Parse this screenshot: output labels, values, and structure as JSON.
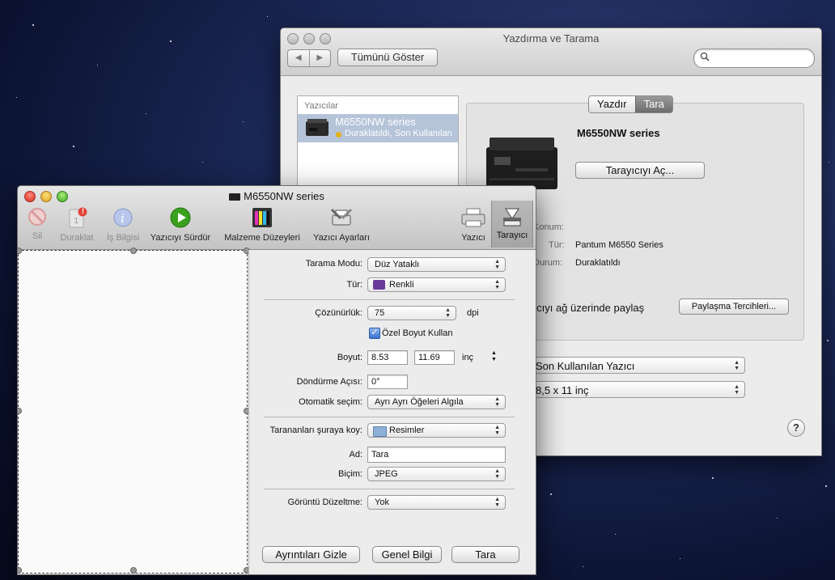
{
  "back_window": {
    "title": "Yazdırma ve Tarama",
    "show_all": "Tümünü Göster",
    "search_placeholder": "",
    "list_header": "Yazıcılar",
    "printer": {
      "name": "M6550NW series",
      "status": "Duraklatıldı, Son Kullanılan"
    },
    "tabs": [
      "Yazdır",
      "Tara"
    ],
    "active_tab": "Tara",
    "detail": {
      "name": "M6550NW series",
      "open_scanner": "Tarayıcıyı Aç...",
      "location_label": "Konum:",
      "kind_label": "Tür:",
      "kind_value": "Pantum M6550 Series",
      "status_label": "Durum:",
      "status_value": "Duraklatıldı",
      "share_text": "yıcıyı ağ üzerinde paylaş",
      "sharing_prefs": "Paylaşma Tercihleri..."
    },
    "default_printer": "Son Kullanılan Yazıcı",
    "paper_size": "8,5 x 11 inç",
    "help": "?"
  },
  "front_window": {
    "title": "M6550NW series",
    "toolbar": {
      "delete": "Sil",
      "pause": "Duraklat",
      "job_info": "İş Bilgisi",
      "resume": "Yazıcıyı Sürdür",
      "supply": "Malzeme Düzeyleri",
      "settings": "Yazıcı Ayarları",
      "printer": "Yazıcı",
      "scanner": "Tarayıcı",
      "pause_badge": "!"
    },
    "options": {
      "scan_mode_label": "Tarama Modu:",
      "scan_mode": "Düz Yataklı",
      "kind_label": "Tür:",
      "kind": "Renkli",
      "resolution_label": "Çözünürlük:",
      "resolution": "75",
      "resolution_unit": "dpi",
      "custom_size": "Özel Boyut Kullan",
      "custom_size_checked": true,
      "size_label": "Boyut:",
      "width": "8.53",
      "height": "11.69",
      "size_unit": "inç",
      "rotation_label": "Döndürme Açısı:",
      "rotation": "0°",
      "auto_select_label": "Otomatik seçim:",
      "auto_select": "Ayrı Ayrı Öğeleri Algıla",
      "destination_label": "Tarananları şuraya koy:",
      "destination": "Resimler",
      "name_label": "Ad:",
      "name": "Tara",
      "format_label": "Biçim:",
      "format": "JPEG",
      "image_correction_label": "Görüntü Düzeltme:",
      "image_correction": "Yok"
    },
    "buttons": {
      "hide_details": "Ayrıntıları Gizle",
      "overview": "Genel Bilgi",
      "scan": "Tara"
    }
  },
  "colors": {
    "selection": "#b5c4d9",
    "pause_badge": "#e0433a",
    "play": "#3aa11e"
  }
}
